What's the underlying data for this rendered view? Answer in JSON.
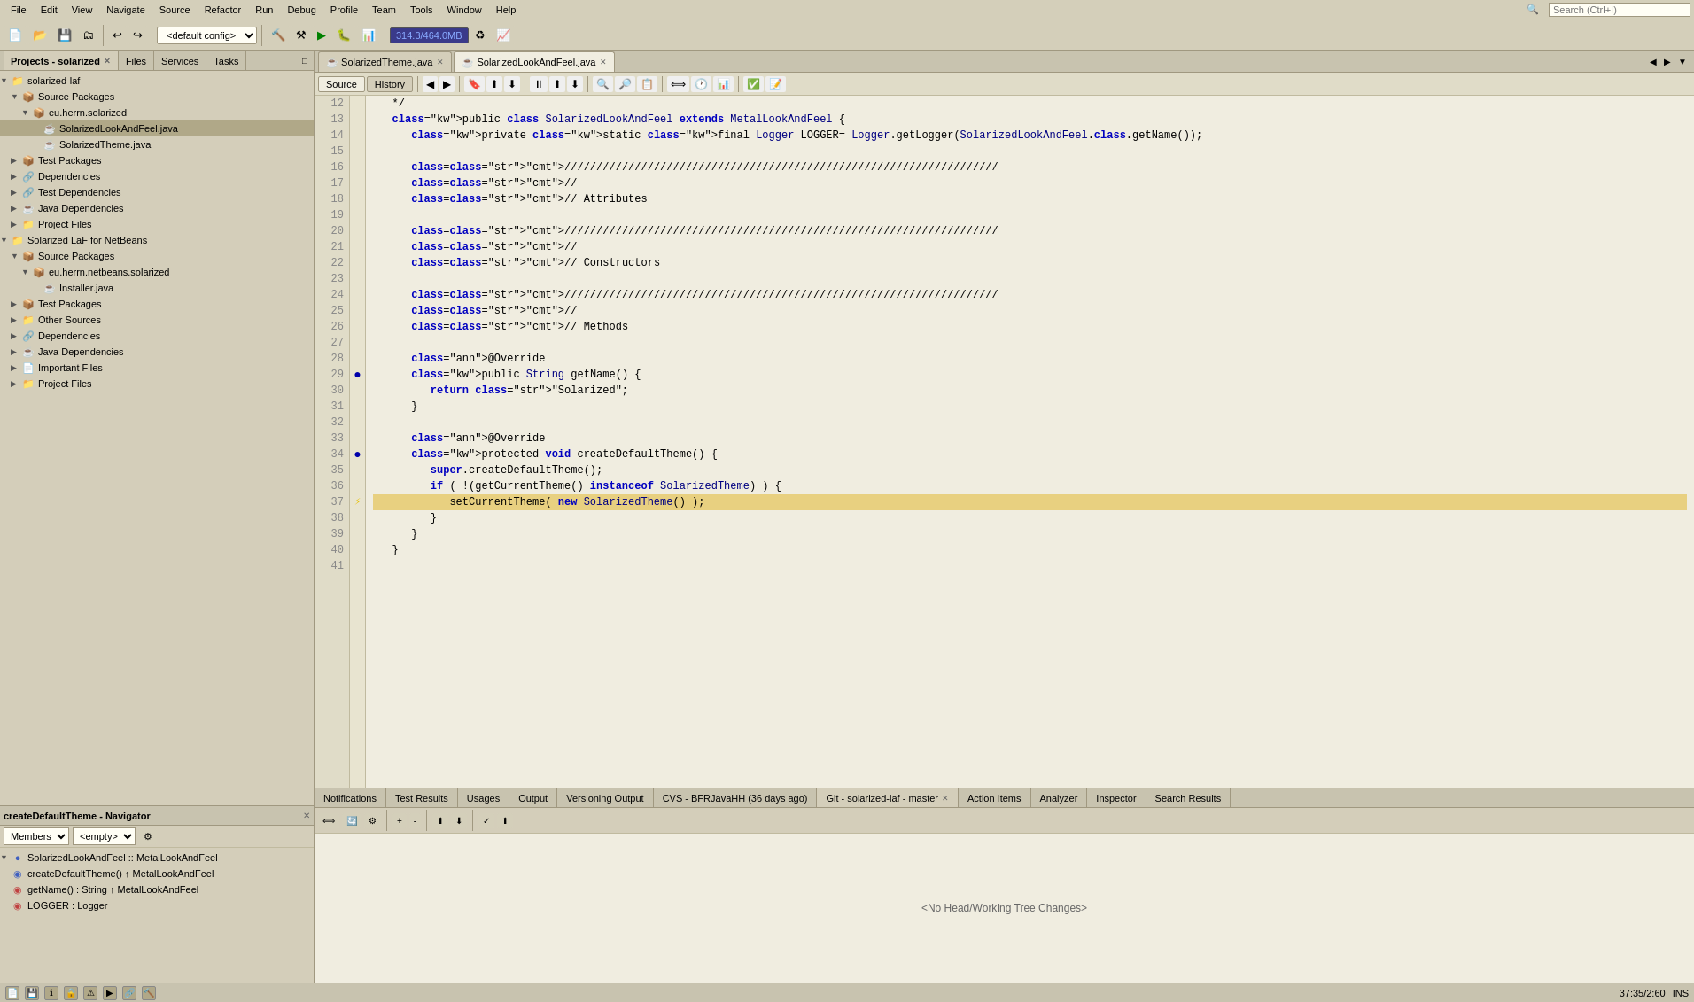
{
  "menubar": {
    "items": [
      "File",
      "Edit",
      "View",
      "Navigate",
      "Source",
      "Refactor",
      "Run",
      "Debug",
      "Profile",
      "Team",
      "Tools",
      "Window",
      "Help"
    ]
  },
  "search": {
    "placeholder": "Search (Ctrl+I)"
  },
  "toolbar": {
    "defaultConfig": "<default config>",
    "memory": "314.3/464.0MB"
  },
  "projectPanel": {
    "title": "Projects - solarized",
    "tabs": [
      "Projects",
      "Files",
      "Services",
      "Tasks"
    ]
  },
  "tree": {
    "items": [
      {
        "indent": 0,
        "arrow": "▼",
        "icon": "📁",
        "label": "solarized-laf",
        "type": "root"
      },
      {
        "indent": 1,
        "arrow": "▼",
        "icon": "📦",
        "label": "Source Packages",
        "type": "package"
      },
      {
        "indent": 2,
        "arrow": "▼",
        "icon": "📦",
        "label": "eu.herrn.solarized",
        "type": "package"
      },
      {
        "indent": 3,
        "arrow": "",
        "icon": "☕",
        "label": "SolarizedLookAndFeel.java",
        "type": "java",
        "selected": true
      },
      {
        "indent": 3,
        "arrow": "",
        "icon": "☕",
        "label": "SolarizedTheme.java",
        "type": "java"
      },
      {
        "indent": 1,
        "arrow": "▶",
        "icon": "📦",
        "label": "Test Packages",
        "type": "package"
      },
      {
        "indent": 1,
        "arrow": "▶",
        "icon": "🔗",
        "label": "Dependencies",
        "type": "deps"
      },
      {
        "indent": 1,
        "arrow": "▶",
        "icon": "🔗",
        "label": "Test Dependencies",
        "type": "deps"
      },
      {
        "indent": 1,
        "arrow": "▶",
        "icon": "☕",
        "label": "Java Dependencies",
        "type": "deps"
      },
      {
        "indent": 1,
        "arrow": "▶",
        "icon": "📁",
        "label": "Project Files",
        "type": "folder"
      },
      {
        "indent": 0,
        "arrow": "▼",
        "icon": "📁",
        "label": "Solarized LaF for NetBeans",
        "type": "root"
      },
      {
        "indent": 1,
        "arrow": "▼",
        "icon": "📦",
        "label": "Source Packages",
        "type": "package"
      },
      {
        "indent": 2,
        "arrow": "▼",
        "icon": "📦",
        "label": "eu.herrn.netbeans.solarized",
        "type": "package"
      },
      {
        "indent": 3,
        "arrow": "",
        "icon": "☕",
        "label": "Installer.java",
        "type": "java"
      },
      {
        "indent": 1,
        "arrow": "▶",
        "icon": "📦",
        "label": "Test Packages",
        "type": "package"
      },
      {
        "indent": 1,
        "arrow": "▶",
        "icon": "📁",
        "label": "Other Sources",
        "type": "folder"
      },
      {
        "indent": 1,
        "arrow": "▶",
        "icon": "🔗",
        "label": "Dependencies",
        "type": "deps"
      },
      {
        "indent": 1,
        "arrow": "▶",
        "icon": "☕",
        "label": "Java Dependencies",
        "type": "deps"
      },
      {
        "indent": 1,
        "arrow": "▶",
        "icon": "📄",
        "label": "Important Files",
        "type": "file"
      },
      {
        "indent": 1,
        "arrow": "▶",
        "icon": "📁",
        "label": "Project Files",
        "type": "folder"
      }
    ]
  },
  "navigator": {
    "title": "createDefaultTheme - Navigator",
    "members_label": "Members",
    "filter_placeholder": "<empty>",
    "root_class": "SolarizedLookAndFeel :: MetalLookAndFeel",
    "members": [
      {
        "indent": 1,
        "icon": "◉",
        "label": "createDefaultTheme() ↑ MetalLookAndFeel",
        "color": "blue"
      },
      {
        "indent": 1,
        "icon": "◉",
        "label": "getName() : String ↑ MetalLookAndFeel",
        "color": "red"
      },
      {
        "indent": 1,
        "icon": "◉",
        "label": "LOGGER : Logger",
        "color": "red"
      }
    ]
  },
  "editorTabs": [
    {
      "label": "SolarizedTheme.java",
      "active": false,
      "closeable": true
    },
    {
      "label": "SolarizedLookAndFeel.java",
      "active": true,
      "closeable": true
    }
  ],
  "editorToolbar": {
    "source_label": "Source",
    "history_label": "History"
  },
  "code": {
    "startLine": 12,
    "lines": [
      {
        "num": 12,
        "text": "   */",
        "gutter": ""
      },
      {
        "num": 13,
        "text": "   public class SolarizedLookAndFeel extends MetalLookAndFeel {",
        "gutter": ""
      },
      {
        "num": 14,
        "text": "      private static final Logger LOGGER= Logger.getLogger(SolarizedLookAndFeel.class.getName());",
        "gutter": ""
      },
      {
        "num": 15,
        "text": "",
        "gutter": ""
      },
      {
        "num": 16,
        "text": "      ////////////////////////////////////////////////////////////////////",
        "gutter": ""
      },
      {
        "num": 17,
        "text": "      //",
        "gutter": ""
      },
      {
        "num": 18,
        "text": "      // Attributes",
        "gutter": ""
      },
      {
        "num": 19,
        "text": "",
        "gutter": ""
      },
      {
        "num": 20,
        "text": "      ////////////////////////////////////////////////////////////////////",
        "gutter": ""
      },
      {
        "num": 21,
        "text": "      //",
        "gutter": ""
      },
      {
        "num": 22,
        "text": "      // Constructors",
        "gutter": ""
      },
      {
        "num": 23,
        "text": "",
        "gutter": ""
      },
      {
        "num": 24,
        "text": "      ////////////////////////////////////////////////////////////////////",
        "gutter": ""
      },
      {
        "num": 25,
        "text": "      //",
        "gutter": ""
      },
      {
        "num": 26,
        "text": "      // Methods",
        "gutter": ""
      },
      {
        "num": 27,
        "text": "",
        "gutter": ""
      },
      {
        "num": 28,
        "text": "      @Override",
        "gutter": ""
      },
      {
        "num": 29,
        "text": "      public String getName() {",
        "gutter": "●"
      },
      {
        "num": 30,
        "text": "         return \"Solarized\";",
        "gutter": ""
      },
      {
        "num": 31,
        "text": "      }",
        "gutter": ""
      },
      {
        "num": 32,
        "text": "",
        "gutter": ""
      },
      {
        "num": 33,
        "text": "      @Override",
        "gutter": ""
      },
      {
        "num": 34,
        "text": "      protected void createDefaultTheme() {",
        "gutter": "●"
      },
      {
        "num": 35,
        "text": "         super.createDefaultTheme();",
        "gutter": ""
      },
      {
        "num": 36,
        "text": "         if ( !(getCurrentTheme() instanceof SolarizedTheme) ) {",
        "gutter": ""
      },
      {
        "num": 37,
        "text": "            setCurrentTheme( new SolarizedTheme() );",
        "gutter": "⚡",
        "highlighted": true
      },
      {
        "num": 38,
        "text": "         }",
        "gutter": ""
      },
      {
        "num": 39,
        "text": "      }",
        "gutter": ""
      },
      {
        "num": 40,
        "text": "   }",
        "gutter": ""
      },
      {
        "num": 41,
        "text": "",
        "gutter": ""
      }
    ]
  },
  "bottomTabs": [
    {
      "label": "Notifications",
      "active": false,
      "closeable": false
    },
    {
      "label": "Test Results",
      "active": false,
      "closeable": false
    },
    {
      "label": "Usages",
      "active": false,
      "closeable": false
    },
    {
      "label": "Output",
      "active": false,
      "closeable": false
    },
    {
      "label": "Versioning Output",
      "active": false,
      "closeable": false
    },
    {
      "label": "CVS - BFRJavaHH (36 days ago)",
      "active": false,
      "closeable": false
    },
    {
      "label": "Git - solarized-laf - master",
      "active": true,
      "closeable": true
    },
    {
      "label": "Action Items",
      "active": false,
      "closeable": false
    },
    {
      "label": "Analyzer",
      "active": false,
      "closeable": false
    },
    {
      "label": "Inspector",
      "active": false,
      "closeable": false
    },
    {
      "label": "Search Results",
      "active": false,
      "closeable": false
    }
  ],
  "bottomContent": {
    "message": "<No Head/Working Tree Changes>"
  },
  "statusBar": {
    "position": "37:35/2:60",
    "ins": "INS"
  }
}
